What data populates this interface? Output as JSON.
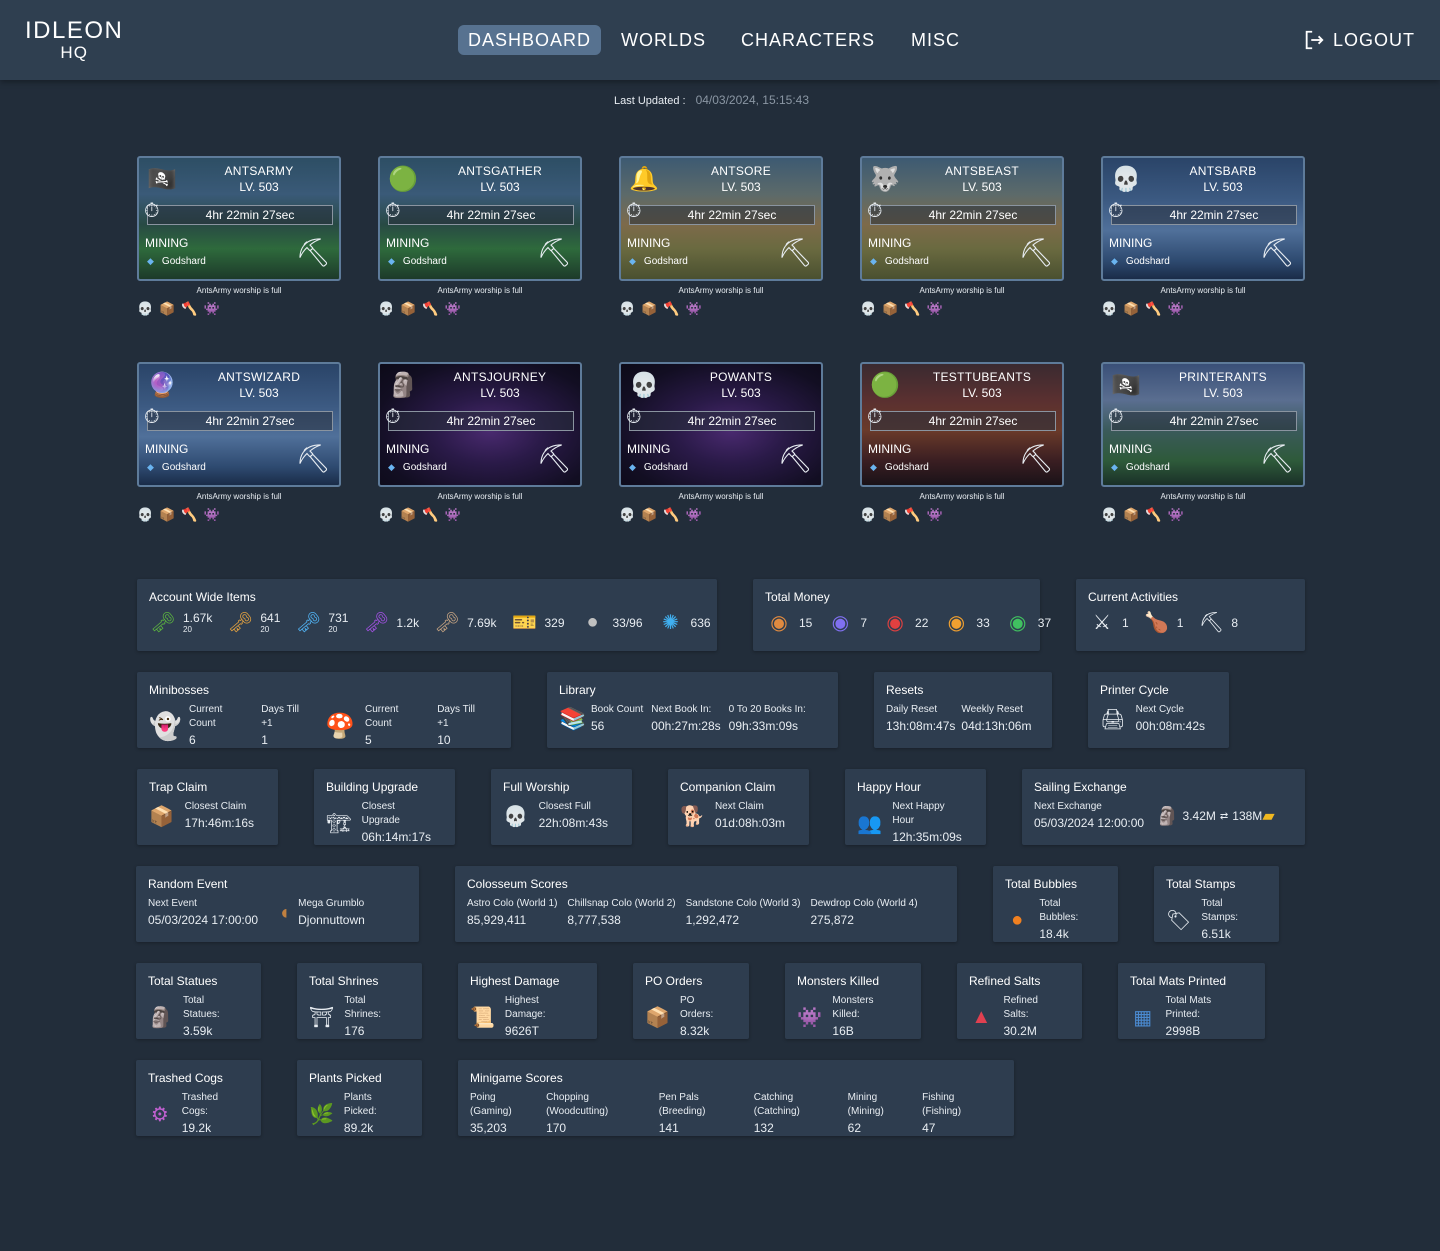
{
  "header": {
    "logo_line1": "IDLEON",
    "logo_line2": "HQ",
    "nav": [
      {
        "label": "DASHBOARD",
        "active": true
      },
      {
        "label": "WORLDS",
        "active": false
      },
      {
        "label": "CHARACTERS",
        "active": false
      },
      {
        "label": "MISC",
        "active": false
      }
    ],
    "logout_label": "LOGOUT"
  },
  "last_updated": {
    "label": "Last Updated :",
    "value": "04/03/2024, 15:15:43"
  },
  "characters": [
    {
      "name": "ANTSARMY",
      "level": "LV. 503",
      "timer": "4hr  22min  27sec",
      "skill": "MINING",
      "target": "Godshard",
      "icon": "pirate-hat",
      "bg": "forest",
      "worship": "AntsArmy worship is full"
    },
    {
      "name": "ANTSGATHER",
      "level": "LV. 503",
      "timer": "4hr  22min  27sec",
      "skill": "MINING",
      "target": "Godshard",
      "icon": "green-slime",
      "bg": "forest",
      "worship": "AntsArmy worship is full"
    },
    {
      "name": "ANTSORE",
      "level": "LV. 503",
      "timer": "4hr  22min  27sec",
      "skill": "MINING",
      "target": "Godshard",
      "icon": "bell-helmet",
      "bg": "desert",
      "worship": "AntsArmy worship is full"
    },
    {
      "name": "ANTSBEAST",
      "level": "LV. 503",
      "timer": "4hr  22min  27sec",
      "skill": "MINING",
      "target": "Godshard",
      "icon": "wolf-branch",
      "bg": "desert",
      "worship": "AntsArmy worship is full"
    },
    {
      "name": "ANTSBARB",
      "level": "LV. 503",
      "timer": "4hr  22min  27sec",
      "skill": "MINING",
      "target": "Godshard",
      "icon": "skull",
      "bg": "snow",
      "worship": "AntsArmy worship is full"
    },
    {
      "name": "ANTSWIZARD",
      "level": "LV. 503",
      "timer": "4hr  22min  27sec",
      "skill": "MINING",
      "target": "Godshard",
      "icon": "magic-orb",
      "bg": "snow",
      "worship": "AntsArmy worship is full"
    },
    {
      "name": "ANTSJOURNEY",
      "level": "LV. 503",
      "timer": "4hr  22min  27sec",
      "skill": "MINING",
      "target": "Godshard",
      "icon": "statue",
      "bg": "space",
      "worship": "AntsArmy worship is full"
    },
    {
      "name": "POWANTS",
      "level": "LV. 503",
      "timer": "4hr  22min  27sec",
      "skill": "MINING",
      "target": "Godshard",
      "icon": "skull",
      "bg": "space",
      "worship": "AntsArmy worship is full"
    },
    {
      "name": "TESTTUBEANTS",
      "level": "LV. 503",
      "timer": "4hr  22min  27sec",
      "skill": "MINING",
      "target": "Godshard",
      "icon": "green-slime",
      "bg": "lava",
      "worship": "AntsArmy worship is full"
    },
    {
      "name": "PRINTERANTS",
      "level": "LV. 503",
      "timer": "4hr  22min  27sec",
      "skill": "MINING",
      "target": "Godshard",
      "icon": "pirate-hat",
      "bg": "mount",
      "worship": "AntsArmy worship is full"
    }
  ],
  "char_status_icons": [
    "worship-skull-icon",
    "box-icon",
    "axe-icon",
    "spiky-monster-icon"
  ],
  "account_wide_items": {
    "title": "Account Wide Items",
    "items": [
      {
        "icon": "green-key",
        "value": "1.67k",
        "sub": "20"
      },
      {
        "icon": "gold-key",
        "value": "641",
        "sub": "20"
      },
      {
        "icon": "ice-key",
        "value": "731",
        "sub": "20"
      },
      {
        "icon": "purple-key",
        "value": "1.2k",
        "sub": ""
      },
      {
        "icon": "skull-key",
        "value": "7.69k",
        "sub": ""
      },
      {
        "icon": "ticket",
        "value": "329",
        "sub": ""
      },
      {
        "icon": "silver-orb",
        "value": "33/96",
        "sub": ""
      },
      {
        "icon": "blue-crystal",
        "value": "636",
        "sub": ""
      }
    ]
  },
  "total_money": {
    "title": "Total Money",
    "items": [
      {
        "icon": "bronze-coin",
        "value": "15"
      },
      {
        "icon": "blue-coin",
        "value": "7"
      },
      {
        "icon": "red-coin",
        "value": "22"
      },
      {
        "icon": "gold-coin",
        "value": "33"
      },
      {
        "icon": "green-coin",
        "value": "37"
      }
    ]
  },
  "current_activities": {
    "title": "Current Activities",
    "items": [
      {
        "icon": "crossed-swords",
        "value": "1"
      },
      {
        "icon": "roast-chicken",
        "value": "1"
      },
      {
        "icon": "pickaxe",
        "value": "8"
      }
    ]
  },
  "minibosses": {
    "title": "Minibosses",
    "bosses": [
      {
        "icon": "ghost",
        "count_label": "Current Count",
        "count": "6",
        "days_label": "Days Till +1",
        "days": "1"
      },
      {
        "icon": "mushroom",
        "count_label": "Current Count",
        "count": "5",
        "days_label": "Days Till +1",
        "days": "10"
      }
    ]
  },
  "library": {
    "title": "Library",
    "cols": [
      {
        "label": "Book Count",
        "value": "56"
      },
      {
        "label": "Next Book In:",
        "value": "00h:27m:28s"
      },
      {
        "label": "0 To 20 Books In:",
        "value": "09h:33m:09s"
      }
    ]
  },
  "resets": {
    "title": "Resets",
    "cols": [
      {
        "label": "Daily Reset",
        "value": "13h:08m:47s"
      },
      {
        "label": "Weekly Reset",
        "value": "04d:13h:06m"
      }
    ]
  },
  "printer_cycle": {
    "title": "Printer Cycle",
    "label": "Next Cycle",
    "value": "00h:08m:42s"
  },
  "trap_claim": {
    "title": "Trap Claim",
    "label": "Closest Claim",
    "value": "17h:46m:16s"
  },
  "building_upgrade": {
    "title": "Building Upgrade",
    "label": "Closest Upgrade",
    "value": "06h:14m:17s"
  },
  "full_worship": {
    "title": "Full Worship",
    "label": "Closest Full",
    "value": "22h:08m:43s"
  },
  "companion_claim": {
    "title": "Companion Claim",
    "label": "Next Claim",
    "value": "01d:08h:03m"
  },
  "happy_hour": {
    "title": "Happy Hour",
    "label": "Next Happy Hour",
    "value": "12h:35m:09s"
  },
  "sailing_exchange": {
    "title": "Sailing Exchange",
    "label": "Next Exchange",
    "value": "05/03/2024 12:00:00",
    "from_value": "3.42M",
    "to_value": "138M"
  },
  "random_event": {
    "title": "Random Event",
    "label": "Next Event",
    "value": "05/03/2024 17:00:00",
    "event_name": "Mega Grumblo",
    "location": "Djonnuttown"
  },
  "colosseum": {
    "title": "Colosseum Scores",
    "cols": [
      {
        "label": "Astro Colo (World 1)",
        "value": "85,929,411"
      },
      {
        "label": "Chillsnap Colo (World 2)",
        "value": "8,777,538"
      },
      {
        "label": "Sandstone Colo (World 3)",
        "value": "1,292,472"
      },
      {
        "label": "Dewdrop Colo (World 4)",
        "value": "275,872"
      }
    ]
  },
  "total_bubbles": {
    "title": "Total Bubbles",
    "label": "Total Bubbles:",
    "value": "18.4k",
    "icon_text": "Bubble"
  },
  "total_stamps": {
    "title": "Total Stamps",
    "label": "Total Stamps:",
    "value": "6.51k"
  },
  "total_statues": {
    "title": "Total Statues",
    "label": "Total Statues:",
    "value": "3.59k"
  },
  "total_shrines": {
    "title": "Total Shrines",
    "label": "Total Shrines:",
    "value": "176"
  },
  "highest_damage": {
    "title": "Highest Damage",
    "label": "Highest Damage:",
    "value": "9626T"
  },
  "po_orders": {
    "title": "PO Orders",
    "label": "PO Orders:",
    "value": "8.32k"
  },
  "monsters_killed": {
    "title": "Monsters Killed",
    "label": "Monsters Killed:",
    "value": "16B"
  },
  "refined_salts": {
    "title": "Refined Salts",
    "label": "Refined Salts:",
    "value": "30.2M"
  },
  "total_mats_printed": {
    "title": "Total Mats Printed",
    "label": "Total Mats Printed:",
    "value": "2998B"
  },
  "trashed_cogs": {
    "title": "Trashed Cogs",
    "label": "Trashed Cogs:",
    "value": "19.2k"
  },
  "plants_picked": {
    "title": "Plants Picked",
    "label": "Plants Picked:",
    "value": "89.2k"
  },
  "minigames": {
    "title": "Minigame Scores",
    "cols": [
      {
        "label": "Poing (Gaming)",
        "value": "35,203"
      },
      {
        "label": "Chopping (Woodcutting)",
        "value": "170"
      },
      {
        "label": "Pen Pals (Breeding)",
        "value": "141"
      },
      {
        "label": "Catching (Catching)",
        "value": "132"
      },
      {
        "label": "Mining (Mining)",
        "value": "62"
      },
      {
        "label": "Fishing (Fishing)",
        "value": "47"
      }
    ]
  }
}
